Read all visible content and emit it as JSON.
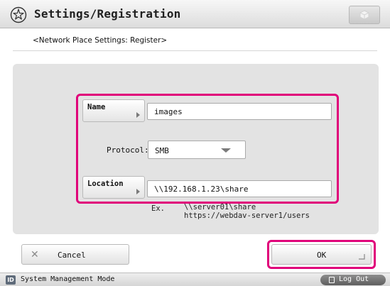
{
  "header": {
    "title": "Settings/Registration",
    "icon": "wrench-star-icon",
    "home_button_icon": "cube-icon"
  },
  "subtitle": "<Network Place Settings: Register>",
  "form": {
    "name": {
      "button_label": "Name",
      "value": "images"
    },
    "protocol": {
      "label": "Protocol:",
      "selected": "SMB"
    },
    "location": {
      "button_label": "Location",
      "value": "\\\\192.168.1.23\\share"
    },
    "example": {
      "label": "Ex.",
      "lines": [
        "\\\\server01\\share",
        "https://webdav-server1/users"
      ]
    }
  },
  "buttons": {
    "cancel": "Cancel",
    "ok": "OK"
  },
  "status_bar": {
    "id_badge": "ID",
    "mode_text": "System Management Mode",
    "logout": "Log Out"
  },
  "colors": {
    "highlight": "#e0007a",
    "panel": "#e3e3e3"
  }
}
